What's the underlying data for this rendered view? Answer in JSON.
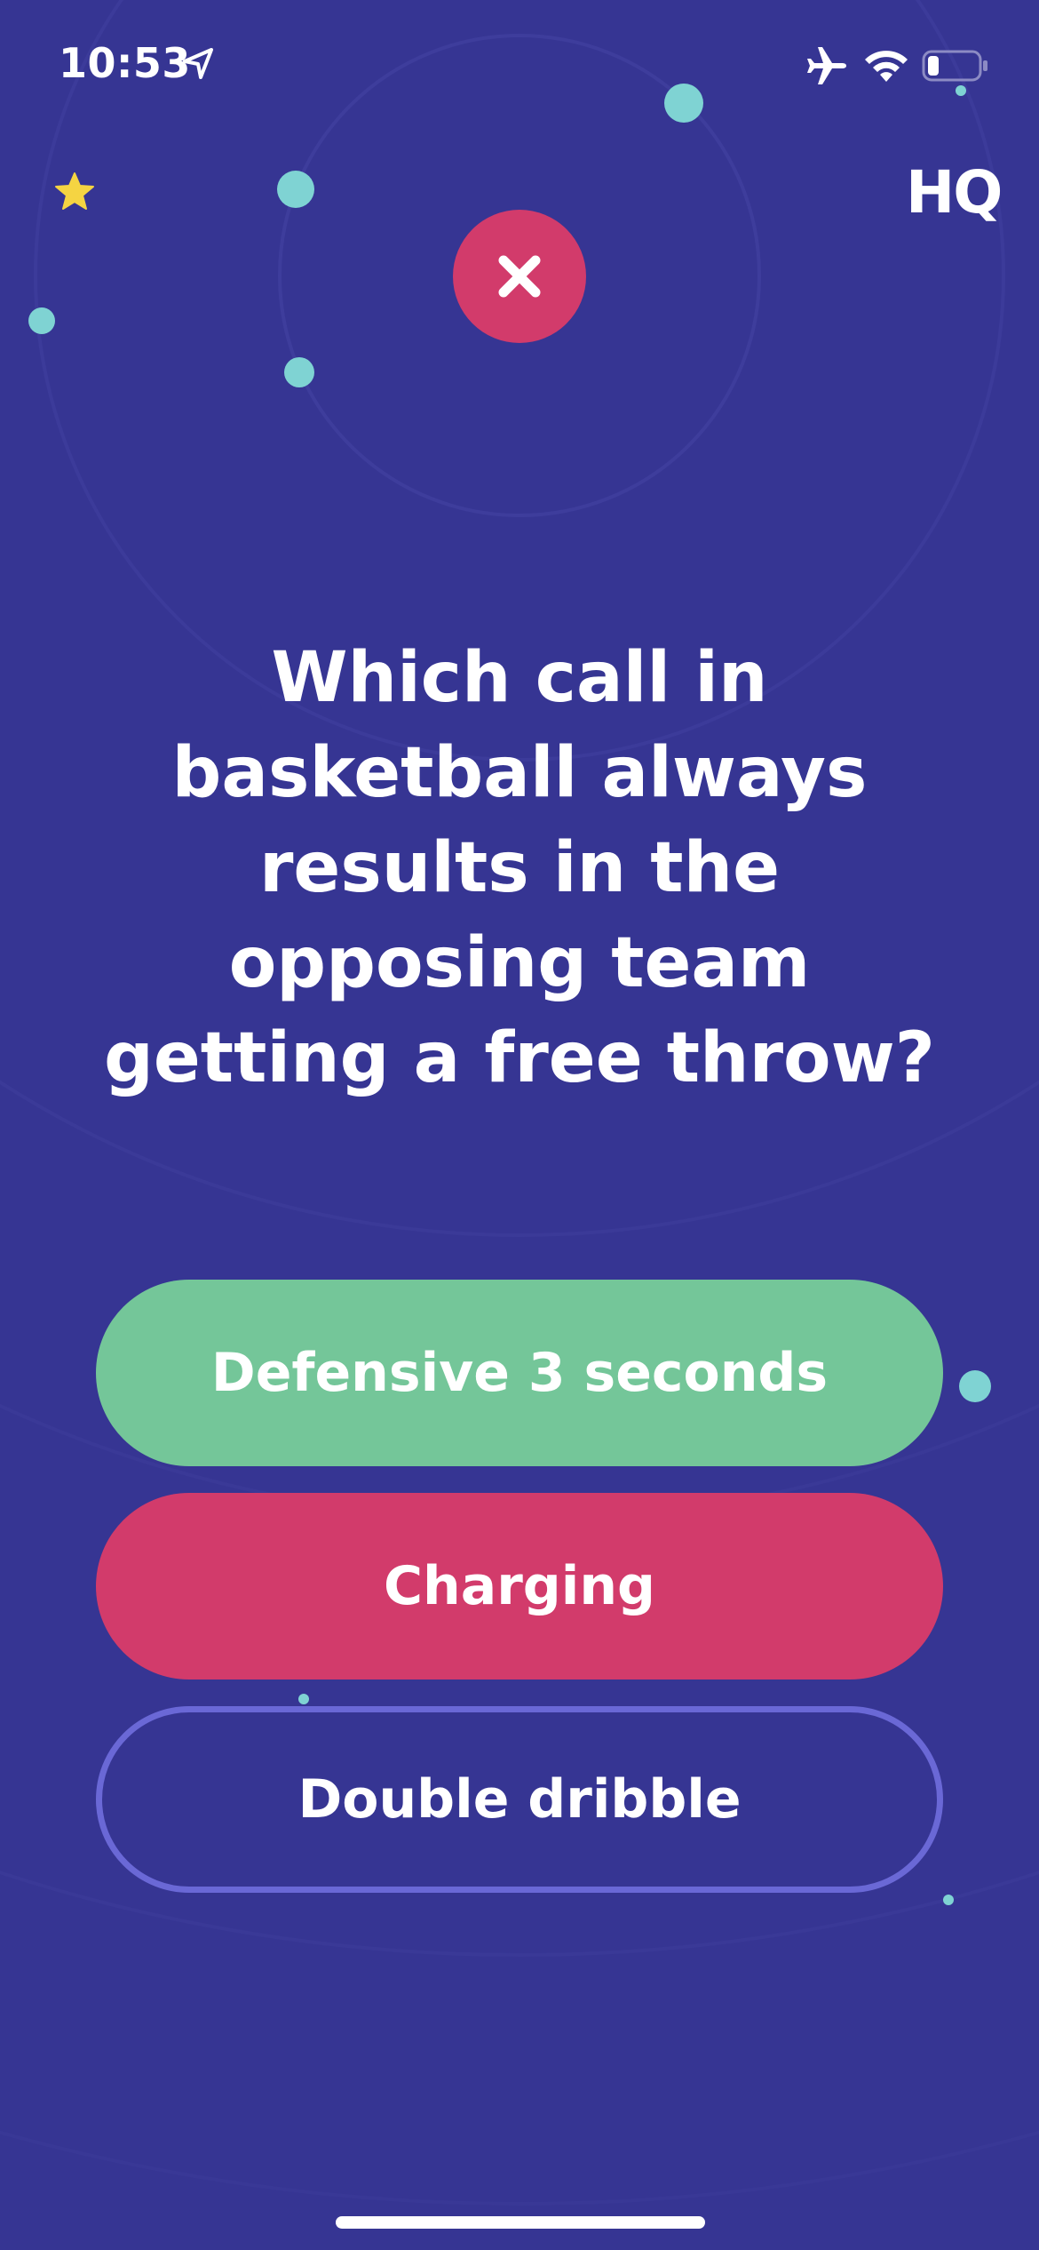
{
  "status_bar": {
    "time": "10:53"
  },
  "header": {
    "logo_text": "HQ"
  },
  "question": {
    "text": "Which call in basketball always results in the opposing team getting a free throw?"
  },
  "answers": [
    {
      "label": "Defensive 3 seconds",
      "state": "correct"
    },
    {
      "label": "Charging",
      "state": "wrong"
    },
    {
      "label": "Double dribble",
      "state": "neutral"
    }
  ],
  "colors": {
    "background": "#363593",
    "correct": "#74c699",
    "wrong": "#d23b6b",
    "neutral_border": "#6a68d6",
    "dot": "#7fd3d3",
    "star": "#f5d442"
  },
  "icons": {
    "status": [
      "location-icon",
      "airplane-icon",
      "wifi-icon",
      "battery-icon"
    ],
    "header": [
      "star-icon",
      "close-icon"
    ]
  }
}
